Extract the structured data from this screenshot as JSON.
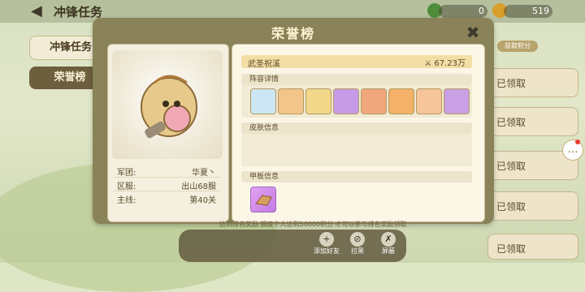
{
  "top_bar": {
    "page_title": "冲锋任务",
    "resources": [
      {
        "value": "0",
        "icon": "green-gem-icon"
      },
      {
        "value": "519",
        "icon": "gold-coin-icon"
      }
    ]
  },
  "side_tabs": [
    "冲锋任务",
    "荣誉榜"
  ],
  "right_list": {
    "claimed_label": "已领取",
    "earn_points": "获取积分"
  },
  "dialog": {
    "title": "荣誉榜",
    "player": {
      "info": [
        {
          "key": "军团:",
          "value": "华夏丶"
        },
        {
          "key": "区服:",
          "value": "出山68服"
        },
        {
          "key": "主线:",
          "value": "第40关"
        }
      ]
    },
    "honor": {
      "name": "武圣祝溪",
      "score": "67.23万"
    },
    "sections": {
      "lineup": "阵容详情",
      "skins": "皮肤信息",
      "deck": "甲板信息"
    }
  },
  "notice": "达到排名奖励 额度个人达到50000积分 才可以参与排名奖励领取",
  "actions": [
    {
      "label": "添加好友",
      "icon": "add-friend-icon"
    },
    {
      "label": "拉黑",
      "icon": "block-icon"
    },
    {
      "label": "屏蔽",
      "icon": "mute-icon"
    }
  ],
  "colors": {
    "accent": "#8a8258",
    "panel": "#fbf6e6",
    "honor_bar": "#f3dea5"
  }
}
